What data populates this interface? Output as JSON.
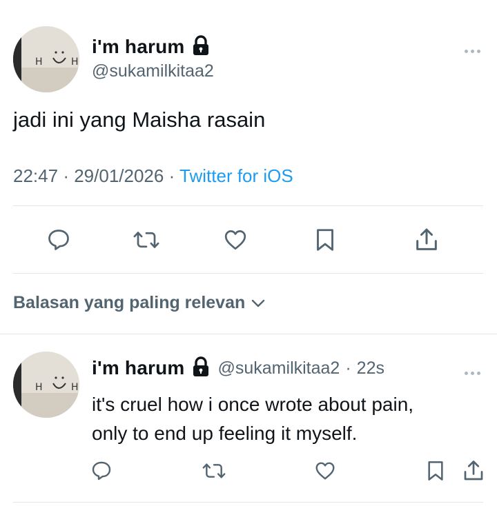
{
  "tweet": {
    "author_name": "i'm harum",
    "author_handle": "@sukamilkitaa2",
    "text": "jadi ini yang Maisha rasain",
    "time": "22:47",
    "date": "29/01/2026",
    "source": "Twitter for iOS",
    "separator": "·"
  },
  "sort": {
    "label": "Balasan yang paling relevan"
  },
  "reply": {
    "author_name": "i'm harum",
    "author_handle": "@sukamilkitaa2",
    "age": "22s",
    "separator": "·",
    "text_line1": "it's cruel how i once wrote about pain,",
    "text_line2": "only to end up feeling it myself."
  },
  "icons": {
    "lock": "lock-icon",
    "reply": "reply-icon",
    "retweet": "retweet-icon",
    "like": "like-icon",
    "bookmark": "bookmark-icon",
    "share": "share-icon",
    "more": "more-icon",
    "chevron": "chevron-down-icon"
  },
  "colors": {
    "text": "#0f1419",
    "muted": "#536471",
    "link": "#1d9bf0",
    "divider": "#e1e6ea"
  }
}
